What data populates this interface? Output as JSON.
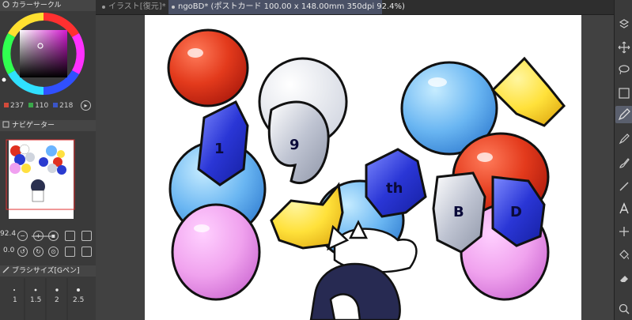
{
  "color_panel": {
    "title": "カラーサークル",
    "r": "237",
    "g": "110",
    "b": "218",
    "color_r": "#d24a3a",
    "color_g": "#3aa84a",
    "color_b": "#3a55c8"
  },
  "navigator": {
    "title": "ナビゲーター",
    "zoom": "92.4",
    "rotation": "0.0"
  },
  "brush_size": {
    "title": "ブラシサイズ[Gペン]",
    "sizes": [
      "1",
      "1.5",
      "2",
      "2.5"
    ]
  },
  "tabs": [
    {
      "label": "イラスト[復元]*"
    },
    {
      "label": "ngoBD* (ポストカード 100.00 x 148.00mm 350dpi 92.4%)"
    }
  ],
  "canvas": {
    "balloon_text": [
      "1",
      "9",
      "th",
      "B",
      "D"
    ]
  }
}
